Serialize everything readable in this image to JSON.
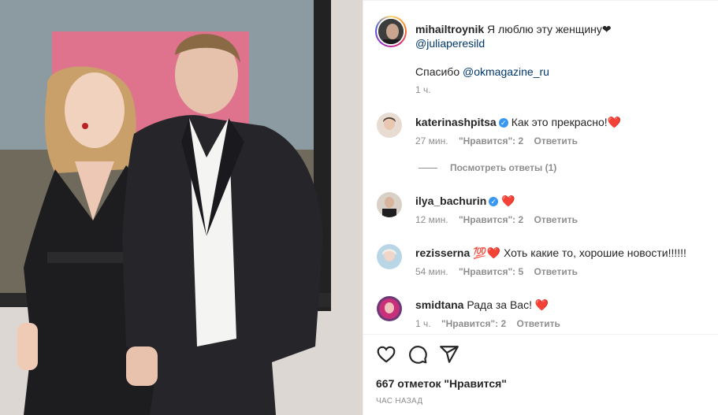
{
  "caption": {
    "username": "mihailtroynik",
    "text": "Я люблю эту женщину",
    "text_heart": "❤",
    "mention": "@juliaperesild",
    "thanks_text": "Спасибо ",
    "thanks_mention": "@okmagazine_ru",
    "time": "1 ч."
  },
  "comments": [
    {
      "username": "katerinashpitsa",
      "verified": true,
      "text": "Как это прекрасно!",
      "emoji": "❤️",
      "time": "27 мин.",
      "likes": "\"Нравится\": 2",
      "reply": "Ответить"
    },
    {
      "username": "ilya_bachurin",
      "verified": true,
      "text": "",
      "emoji": "❤️",
      "time": "12 мин.",
      "likes": "\"Нравится\": 2",
      "reply": "Ответить"
    },
    {
      "username": "rezisserna",
      "verified": false,
      "prefix_emoji": "💯❤️",
      "text": "Хоть какие то, хорошие новости!!!!!!",
      "emoji": "",
      "time": "54 мин.",
      "likes": "\"Нравится\": 5",
      "reply": "Ответить"
    },
    {
      "username": "smidtana",
      "verified": false,
      "text": "Рада за Вас!",
      "emoji": "❤️",
      "time": "1 ч.",
      "likes": "\"Нравится\": 2",
      "reply": "Ответить"
    }
  ],
  "view_replies": "Посмотреть ответы (1)",
  "likes_count": "667 отметок \"Нравится\"",
  "posted_ago": "ЧАС НАЗАД",
  "icons": {
    "like": "heart-icon",
    "comment": "comment-icon",
    "share": "share-icon",
    "verified": "verified-badge-icon"
  },
  "colors": {
    "link": "#00376b",
    "muted": "#8e8e8e",
    "verified": "#3897f0",
    "heart": "#ed4956"
  }
}
